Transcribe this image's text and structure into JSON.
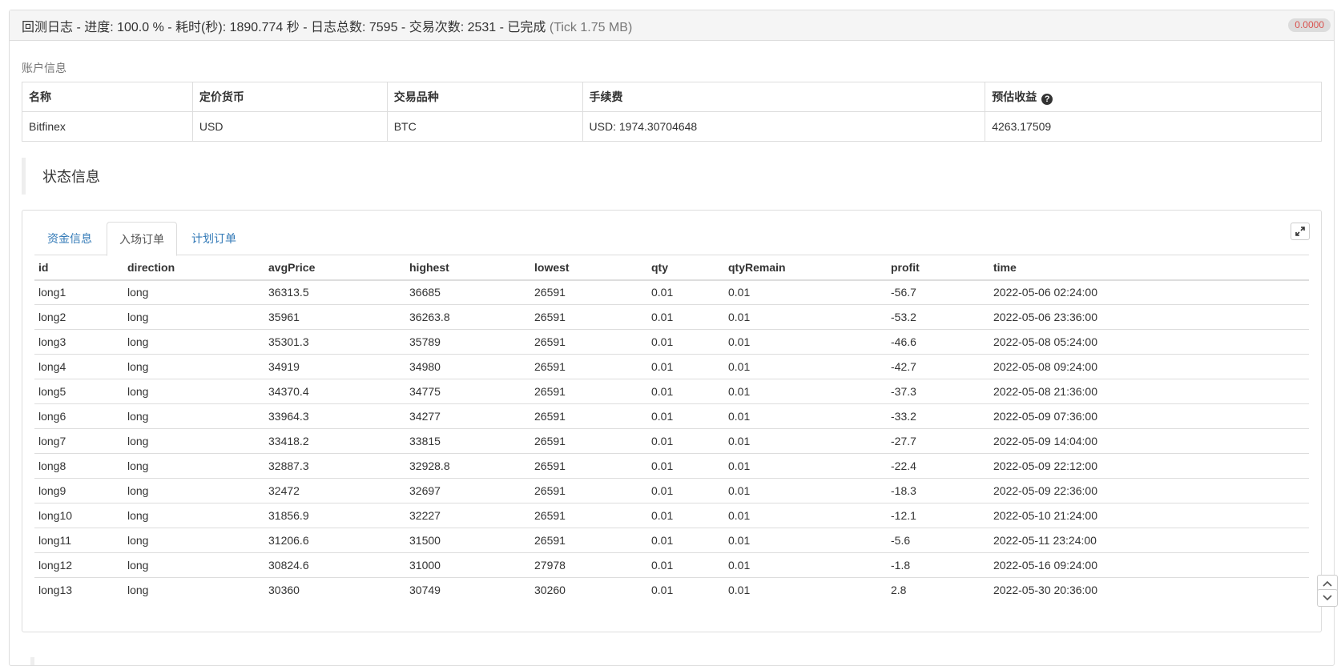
{
  "header": {
    "title": "回测日志 - 进度: 100.0 % - 耗时(秒): 1890.774 秒 - 日志总数: 7595 - 交易次数: 2531 - 已完成",
    "tick_info": "(Tick 1.75 MB)",
    "score_badge": "0.0000"
  },
  "account": {
    "section_label": "账户信息",
    "columns": [
      "名称",
      "定价货币",
      "交易品种",
      "手续费",
      "预估收益"
    ],
    "row": [
      "Bitfinex",
      "USD",
      "BTC",
      "USD: 1974.30704648",
      "4263.17509"
    ],
    "help_icon": "question-circle-icon"
  },
  "status": {
    "title": "状态信息"
  },
  "tabs": [
    {
      "label": "资金信息",
      "active": false
    },
    {
      "label": "入场订单",
      "active": true
    },
    {
      "label": "计划订单",
      "active": false
    }
  ],
  "orders": {
    "columns": [
      "id",
      "direction",
      "avgPrice",
      "highest",
      "lowest",
      "qty",
      "qtyRemain",
      "profit",
      "time"
    ],
    "rows": [
      [
        "long1",
        "long",
        "36313.5",
        "36685",
        "26591",
        "0.01",
        "0.01",
        "-56.7",
        "2022-05-06 02:24:00"
      ],
      [
        "long2",
        "long",
        "35961",
        "36263.8",
        "26591",
        "0.01",
        "0.01",
        "-53.2",
        "2022-05-06 23:36:00"
      ],
      [
        "long3",
        "long",
        "35301.3",
        "35789",
        "26591",
        "0.01",
        "0.01",
        "-46.6",
        "2022-05-08 05:24:00"
      ],
      [
        "long4",
        "long",
        "34919",
        "34980",
        "26591",
        "0.01",
        "0.01",
        "-42.7",
        "2022-05-08 09:24:00"
      ],
      [
        "long5",
        "long",
        "34370.4",
        "34775",
        "26591",
        "0.01",
        "0.01",
        "-37.3",
        "2022-05-08 21:36:00"
      ],
      [
        "long6",
        "long",
        "33964.3",
        "34277",
        "26591",
        "0.01",
        "0.01",
        "-33.2",
        "2022-05-09 07:36:00"
      ],
      [
        "long7",
        "long",
        "33418.2",
        "33815",
        "26591",
        "0.01",
        "0.01",
        "-27.7",
        "2022-05-09 14:04:00"
      ],
      [
        "long8",
        "long",
        "32887.3",
        "32928.8",
        "26591",
        "0.01",
        "0.01",
        "-22.4",
        "2022-05-09 22:12:00"
      ],
      [
        "long9",
        "long",
        "32472",
        "32697",
        "26591",
        "0.01",
        "0.01",
        "-18.3",
        "2022-05-09 22:36:00"
      ],
      [
        "long10",
        "long",
        "31856.9",
        "32227",
        "26591",
        "0.01",
        "0.01",
        "-12.1",
        "2022-05-10 21:24:00"
      ],
      [
        "long11",
        "long",
        "31206.6",
        "31500",
        "26591",
        "0.01",
        "0.01",
        "-5.6",
        "2022-05-11 23:24:00"
      ],
      [
        "long12",
        "long",
        "30824.6",
        "31000",
        "27978",
        "0.01",
        "0.01",
        "-1.8",
        "2022-05-16 09:24:00"
      ],
      [
        "long13",
        "long",
        "30360",
        "30749",
        "30260",
        "0.01",
        "0.01",
        "2.8",
        "2022-05-30 20:36:00"
      ]
    ]
  },
  "icons": {
    "expand": "expand-icon",
    "scroll_up": "chevron-up-icon",
    "scroll_down": "chevron-down-icon"
  }
}
